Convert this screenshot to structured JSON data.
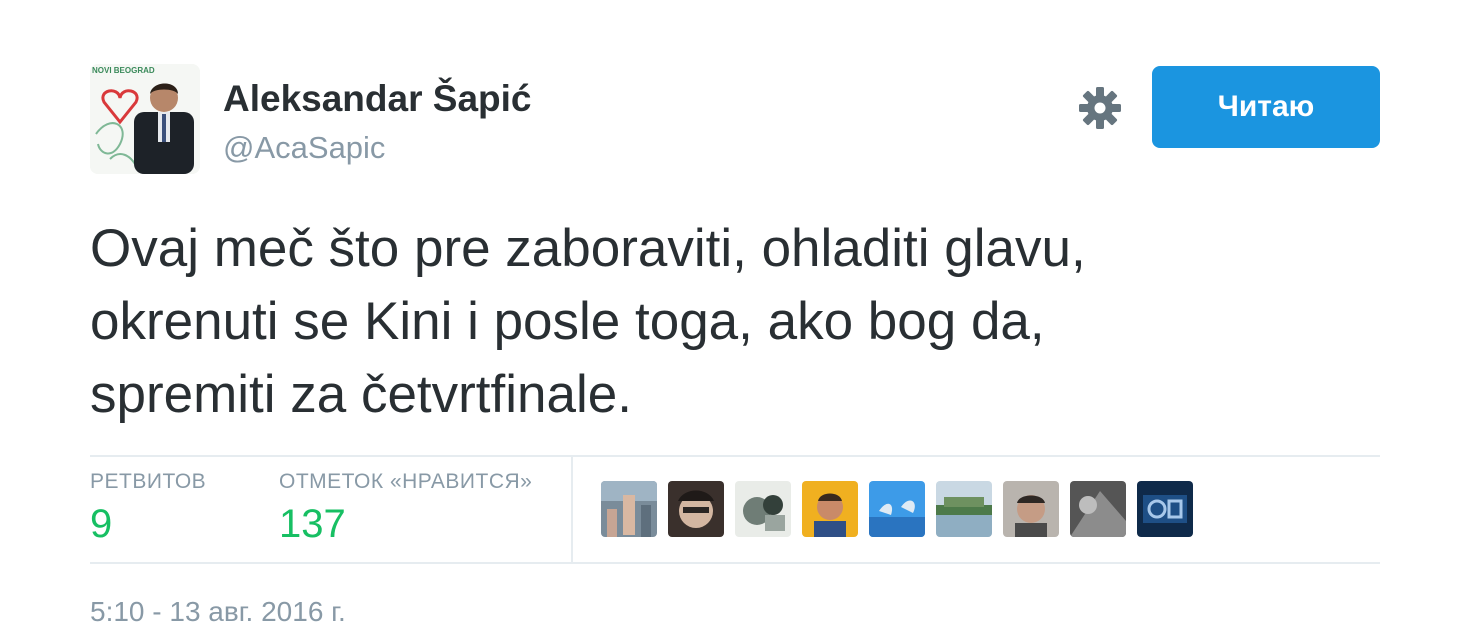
{
  "author": {
    "display_name": "Aleksandar Šapić",
    "handle": "@AcaSapic",
    "avatar_caption": "NOVI BEOGRAD"
  },
  "header": {
    "settings_icon": "gear-icon",
    "follow_label": "Читаю"
  },
  "tweet": {
    "text_lines": [
      "Ovaj meč što pre zaboraviti, ohladiti glavu,",
      "okrenuti se Kini i posle toga, ako bog da,",
      "spremiti za četvrtfinale."
    ]
  },
  "stats": {
    "retweets_label": "РЕТВИТОВ",
    "retweets_count": "9",
    "likes_label": "ОТМЕТОК «НРАВИТСЯ»",
    "likes_count": "137"
  },
  "likers": [
    {
      "name": "liker-avatar-1"
    },
    {
      "name": "liker-avatar-2"
    },
    {
      "name": "liker-avatar-3"
    },
    {
      "name": "liker-avatar-4"
    },
    {
      "name": "liker-avatar-5"
    },
    {
      "name": "liker-avatar-6"
    },
    {
      "name": "liker-avatar-7"
    },
    {
      "name": "liker-avatar-8"
    },
    {
      "name": "liker-avatar-9"
    }
  ],
  "timestamp": "5:10 - 13 авг. 2016 г.",
  "colors": {
    "accent": "#1b95e0",
    "count_green": "#17bf63",
    "muted": "#8899a6",
    "text": "#292f33"
  }
}
